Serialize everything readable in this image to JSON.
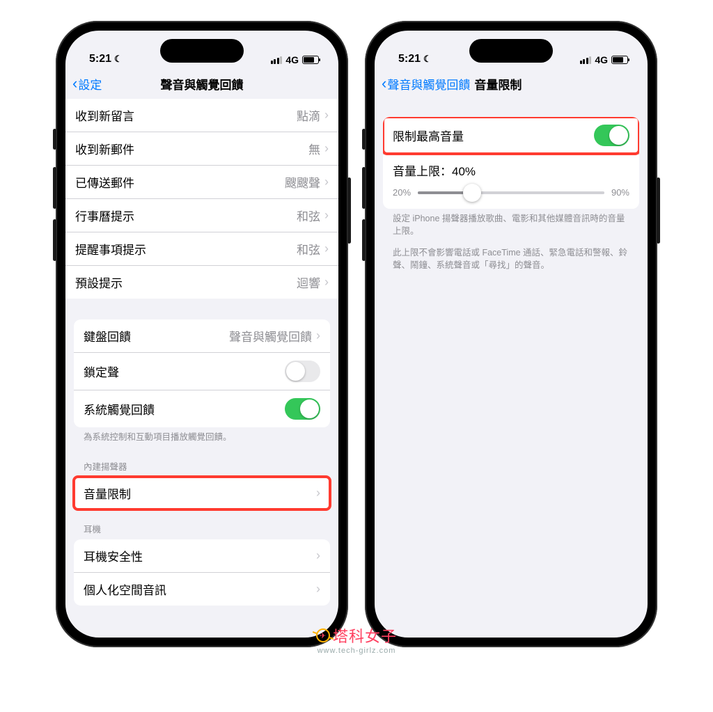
{
  "status": {
    "time": "5:21",
    "net": "4G"
  },
  "left": {
    "back": "設定",
    "title": "聲音與觸覺回饋",
    "rows1": [
      {
        "label": "收到新留言",
        "value": "點滴"
      },
      {
        "label": "收到新郵件",
        "value": "無"
      },
      {
        "label": "已傳送郵件",
        "value": "颼颼聲"
      },
      {
        "label": "行事曆提示",
        "value": "和弦"
      },
      {
        "label": "提醒事項提示",
        "value": "和弦"
      },
      {
        "label": "預設提示",
        "value": "迴響"
      }
    ],
    "rows2": {
      "keyboard": {
        "label": "鍵盤回饋",
        "value": "聲音與觸覺回饋"
      },
      "lock": {
        "label": "鎖定聲"
      },
      "haptic": {
        "label": "系統觸覺回饋"
      }
    },
    "note2": "為系統控制和互動項目播放觸覺回饋。",
    "hdr_speaker": "內建揚聲器",
    "volume_limit": "音量限制",
    "hdr_headphone": "耳機",
    "rows4": [
      {
        "label": "耳機安全性"
      },
      {
        "label": "個人化空間音訊"
      }
    ]
  },
  "right": {
    "back": "聲音與觸覺回饋",
    "title": "音量限制",
    "toggle_label": "限制最高音量",
    "slider_caption": "音量上限：40%",
    "slider_min": "20%",
    "slider_max": "90%",
    "slider_percent": 29,
    "note1": "設定 iPhone 揚聲器播放歌曲、電影和其他媒體音訊時的音量上限。",
    "note2": "此上限不會影響電話或 FaceTime 通話、緊急電話和警報、鈴聲、鬧鐘、系統聲音或「尋找」的聲音。"
  },
  "watermark": {
    "main": "塔科女子",
    "sub": "www.tech-girlz.com"
  }
}
